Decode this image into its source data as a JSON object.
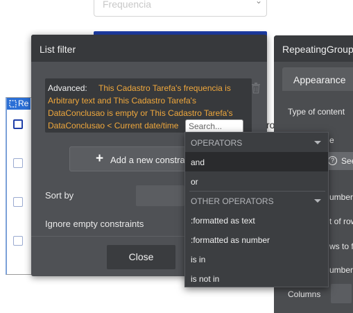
{
  "background": {
    "dropdown_value": "Frequencia",
    "repeating_group_tag": "Re",
    "fragment_text": "ro"
  },
  "list_filter": {
    "title": "List filter",
    "advanced_label": "Advanced:",
    "expression_lines": [
      "This Cadastro Tarefa's frequencia is",
      "Arbitrary text and This Cadastro Tarefa's",
      "DataConclusao is empty or This Cadastro Tarefa's",
      "DataConclusao < Current date/time"
    ],
    "search_placeholder": "Search...",
    "add_constraint_label": "Add a new constraint",
    "sort_by_label": "Sort by",
    "ignore_empty_label": "Ignore empty constraints",
    "close_label": "Close"
  },
  "operators_dropdown": {
    "operators_heading": "OPERATORS",
    "operators": [
      "and",
      "or"
    ],
    "other_heading": "OTHER OPERATORS",
    "other_operators": [
      ":formatted as text",
      ":formatted as number",
      "is in",
      "is not in"
    ]
  },
  "repeating_group_panel": {
    "title": "RepeatingGroup",
    "tab_label": "Appearance",
    "type_of_content_label": "Type of content",
    "partial_labels": [
      "e",
      "umber",
      "t of row",
      "ws to fi",
      "umber"
    ],
    "columns_label": "Columns",
    "see_button_label": "See"
  },
  "colors": {
    "expression_text": "#f0a83c",
    "dialog_bg": "#4f5155",
    "header_bg": "#37393c",
    "accent_blue": "#2b6fd6"
  }
}
